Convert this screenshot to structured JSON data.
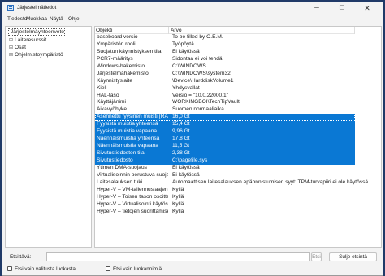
{
  "window": {
    "title": "Järjestelmätiedot",
    "controls": {
      "minimize": "─",
      "maximize": "☐",
      "close": "✕"
    }
  },
  "menu": [
    "Tiedosto",
    "Muokkaa",
    "Näytä",
    "Ohje"
  ],
  "tree": {
    "root": "Järjestelmäyhteenveto",
    "nodes": [
      {
        "expander": "⊞",
        "label": "Laiteresurssit"
      },
      {
        "expander": "⊞",
        "label": "Osat"
      },
      {
        "expander": "⊞",
        "label": "Ohjelmistoympäristö"
      }
    ]
  },
  "table": {
    "headers": [
      "Objekti",
      "Arvo"
    ],
    "rows": [
      [
        "baseboard versio",
        "To be filled by O.E.M."
      ],
      [
        "Ympäristön rooli",
        "Työpöytä"
      ],
      [
        "Suojatun käynnistyksen tila",
        "Ei käytössä"
      ],
      [
        "PCR7-määritys",
        "Sidontaa ei voi tehdä"
      ],
      [
        "Windows-hakemisto",
        "C:\\WINDOWS"
      ],
      [
        "Järjestelmähakemisto",
        "C:\\WINDOWS\\system32"
      ],
      [
        "Käynnistyslaite",
        "\\Device\\HarddiskVolume1"
      ],
      [
        "Kieli",
        "Yhdysvallat"
      ],
      [
        "HAL-taso",
        "Versio = \"10.0.22000.1\""
      ],
      [
        "Käyttäjänimi",
        "WORKINGBOI\\TechTipVault"
      ],
      [
        "Aikavyöhyke",
        "Suomen normaaliaika"
      ],
      [
        "Asennettu fyysinen muisti (RAM)",
        "16,0 Gt"
      ],
      [
        "Fyysistä muistia yhteensä",
        "15,4 Gt"
      ],
      [
        "Fyysistä muistia vapaana",
        "9,96 Gt"
      ],
      [
        "Näennäismuistia yhteensä",
        "17,8 Gt"
      ],
      [
        "Näennäismuistia vapaana",
        "11,5 Gt"
      ],
      [
        "Sivutustiedoston tila",
        "2,38 Gt"
      ],
      [
        "Sivutustiedosto",
        "C:\\pagefile.sys"
      ],
      [
        "Ytimen DMA-suojaus",
        "Ei käytössä"
      ],
      [
        "Virtualisoinnin perustuva suojaus",
        "Ei käytössä"
      ],
      [
        "Laitesalauksen tuki",
        "Automaattisen laitesalauksen epäonnistumisen syyt: TPM-turvapiiri ei ole käytössä"
      ],
      [
        "Hyper-V – VM-tallennuslaajennus",
        "Kyllä"
      ],
      [
        "Hyper-V – Toisen tason osoitteet",
        "Kyllä"
      ],
      [
        "Hyper-V – Virtualisointi käytössä",
        "Kyllä"
      ],
      [
        "Hyper-V – tietojen suorittamise...",
        "Kyllä"
      ]
    ],
    "selected_rows": [
      11,
      12,
      13,
      14,
      15,
      16,
      17
    ]
  },
  "find": {
    "label": "Etsittävä:",
    "value": "",
    "find_button": "Etsi",
    "close_button": "Sulje etsintä",
    "check_selected_category": "Etsi vain valitusta luokasta",
    "check_category_names": "Etsi vain luokannimiä"
  },
  "colors": {
    "selection": "#0a78d4",
    "desktop": "#203a68"
  }
}
